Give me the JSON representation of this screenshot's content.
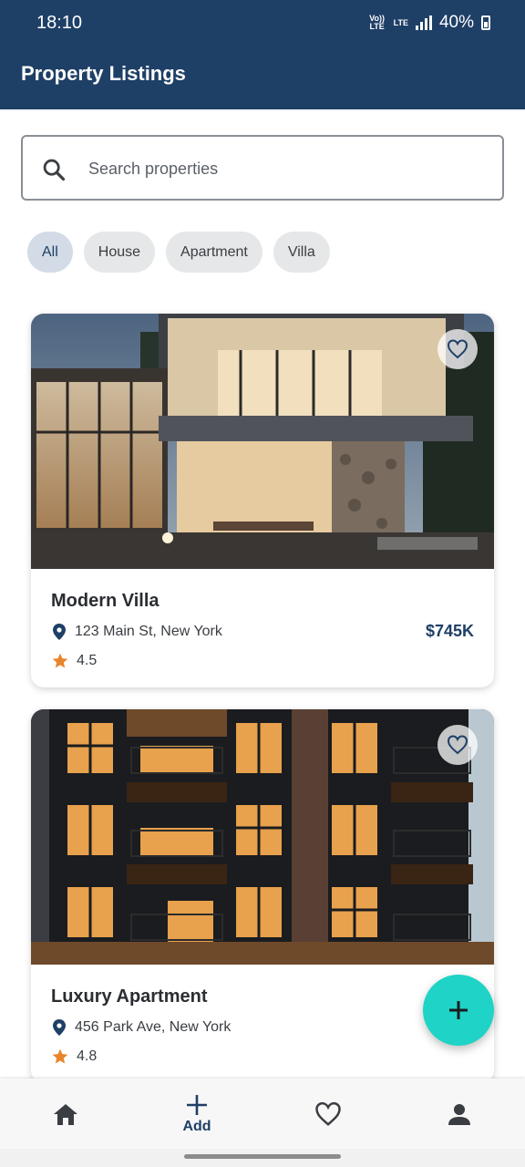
{
  "status": {
    "time": "18:10",
    "net1": "Vo)) LTE",
    "net2": "LTE",
    "battery": "40%"
  },
  "appbar": {
    "title": "Property Listings"
  },
  "search": {
    "placeholder": "Search properties",
    "value": ""
  },
  "filters": [
    {
      "label": "All",
      "active": true
    },
    {
      "label": "House",
      "active": false
    },
    {
      "label": "Apartment",
      "active": false
    },
    {
      "label": "Villa",
      "active": false
    }
  ],
  "listings": [
    {
      "title": "Modern Villa",
      "address": "123 Main St, New York",
      "price": "$745K",
      "rating": "4.5",
      "favorite": false
    },
    {
      "title": "Luxury Apartment",
      "address": "456 Park Ave, New York",
      "price": "",
      "rating": "4.8",
      "favorite": false
    }
  ],
  "nav": {
    "home_icon": "home-icon",
    "add_label": "Add",
    "favorites_icon": "heart-icon",
    "profile_icon": "person-icon"
  },
  "colors": {
    "primary": "#1e3f66",
    "fab": "#1fd3c6",
    "star": "#e8842a",
    "chip_active": "#d2dbe6"
  }
}
